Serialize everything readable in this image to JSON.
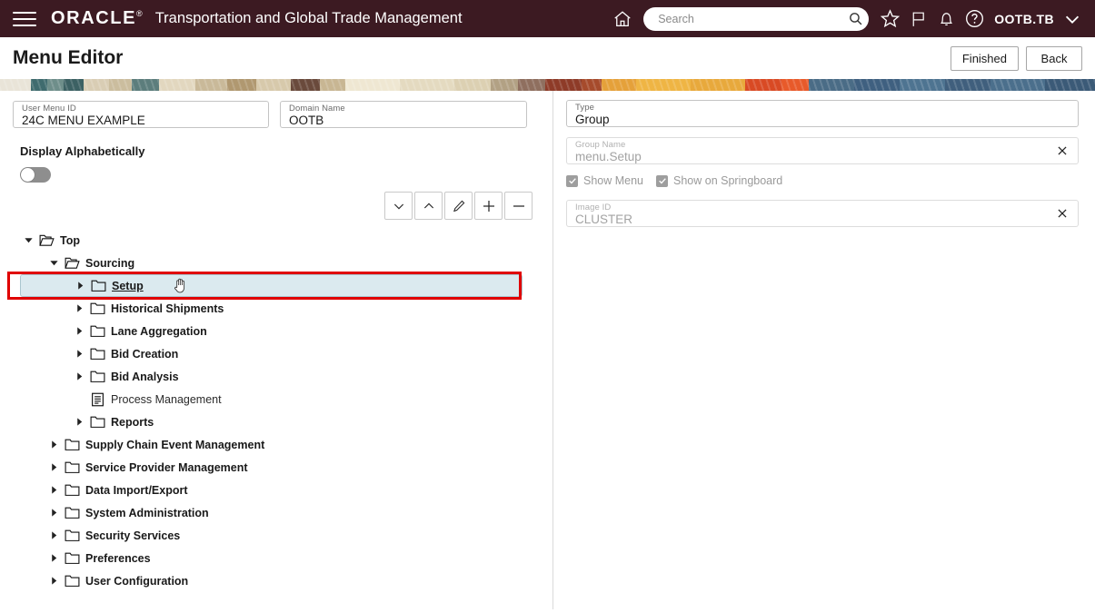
{
  "appbar": {
    "menu_icon": "hamburger-icon",
    "brand": "ORACLE",
    "brand_mark": "®",
    "app_title": "Transportation and Global Trade Management",
    "home_icon": "home-icon",
    "search": {
      "value": "",
      "placeholder": "Search",
      "icon": "search-icon"
    },
    "favorites_icon": "star-icon",
    "flag_icon": "flag-icon",
    "notifications_icon": "bell-icon",
    "help_icon": "help-circle-icon",
    "user": "OOTB.TB",
    "user_chevron_icon": "chevron-down-icon"
  },
  "page": {
    "title": "Menu Editor",
    "finished_label": "Finished",
    "back_label": "Back"
  },
  "left": {
    "user_menu_id": {
      "label": "User Menu ID",
      "value": "24C MENU EXAMPLE"
    },
    "domain_name": {
      "label": "Domain Name",
      "value": "OOTB"
    },
    "display_alphabetically": {
      "label": "Display Alphabetically",
      "state": "off"
    },
    "toolbar": [
      {
        "name": "move-down-button",
        "icon": "chevron-down-icon"
      },
      {
        "name": "move-up-button",
        "icon": "chevron-up-icon"
      },
      {
        "name": "edit-button",
        "icon": "pencil-icon"
      },
      {
        "name": "add-button",
        "icon": "plus-icon"
      },
      {
        "name": "remove-button",
        "icon": "minus-icon"
      }
    ],
    "tree": [
      {
        "label": "Top",
        "level": 0,
        "icon": "folder-open-icon",
        "twist": "expanded",
        "selected": false
      },
      {
        "label": "Sourcing",
        "level": 1,
        "icon": "folder-open-icon",
        "twist": "expanded",
        "selected": false
      },
      {
        "label": "Setup",
        "level": 2,
        "icon": "folder-icon",
        "twist": "collapsed",
        "selected": true
      },
      {
        "label": "Historical Shipments",
        "level": 2,
        "icon": "folder-icon",
        "twist": "collapsed",
        "selected": false
      },
      {
        "label": "Lane Aggregation",
        "level": 2,
        "icon": "folder-icon",
        "twist": "collapsed",
        "selected": false
      },
      {
        "label": "Bid Creation",
        "level": 2,
        "icon": "folder-icon",
        "twist": "collapsed",
        "selected": false
      },
      {
        "label": "Bid Analysis",
        "level": 2,
        "icon": "folder-icon",
        "twist": "collapsed",
        "selected": false
      },
      {
        "label": "Process Management",
        "level": 2,
        "icon": "document-icon",
        "twist": "none",
        "selected": false
      },
      {
        "label": "Reports",
        "level": 2,
        "icon": "folder-icon",
        "twist": "collapsed",
        "selected": false
      },
      {
        "label": "Supply Chain Event Management",
        "level": 1,
        "icon": "folder-icon",
        "twist": "collapsed",
        "selected": false
      },
      {
        "label": "Service Provider Management",
        "level": 1,
        "icon": "folder-icon",
        "twist": "collapsed",
        "selected": false
      },
      {
        "label": "Data Import/Export",
        "level": 1,
        "icon": "folder-icon",
        "twist": "collapsed",
        "selected": false
      },
      {
        "label": "System Administration",
        "level": 1,
        "icon": "folder-icon",
        "twist": "collapsed",
        "selected": false
      },
      {
        "label": "Security Services",
        "level": 1,
        "icon": "folder-icon",
        "twist": "collapsed",
        "selected": false
      },
      {
        "label": "Preferences",
        "level": 1,
        "icon": "folder-icon",
        "twist": "collapsed",
        "selected": false
      },
      {
        "label": "User Configuration",
        "level": 1,
        "icon": "folder-icon",
        "twist": "collapsed",
        "selected": false
      }
    ],
    "cursor_icon": "grab-hand-cursor",
    "annotation_color": "#e00000"
  },
  "right": {
    "type": {
      "label": "Type",
      "value": "Group",
      "disabled": false
    },
    "group_name": {
      "label": "Group Name",
      "value": "menu.Setup",
      "disabled": true,
      "clear_icon": "close-icon"
    },
    "show_menu": {
      "label": "Show Menu",
      "checked": true,
      "disabled": true
    },
    "show_on_springboard": {
      "label": "Show on Springboard",
      "checked": true,
      "disabled": true
    },
    "image_id": {
      "label": "Image ID",
      "value": "CLUSTER",
      "disabled": true,
      "clear_icon": "close-icon"
    }
  },
  "colors": {
    "header_bg": "#3c1a22",
    "selected_row_bg": "#dbeaef",
    "annotation_red": "#e00000"
  }
}
